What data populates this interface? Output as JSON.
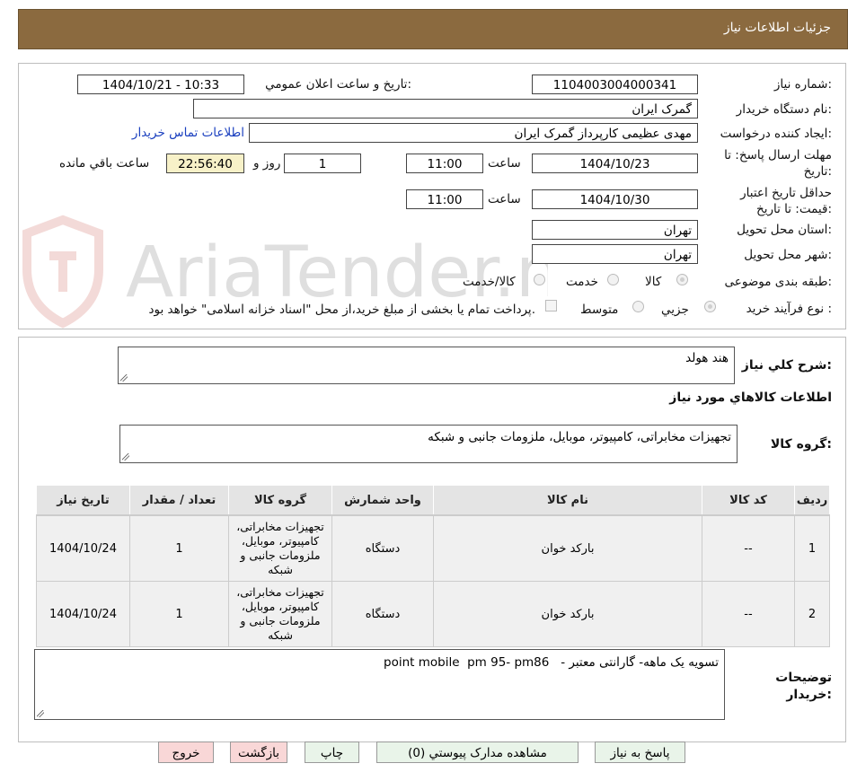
{
  "header": {
    "title": "جزئیات اطلاعات نیاز"
  },
  "form": {
    "need_number_label": "شماره نیاز:",
    "need_number": "1104003004000341",
    "announce_label": "تاریخ و ساعت اعلان عمومي:",
    "announce_value": "1404/10/21 - 10:33",
    "buyer_label": "نام دستگاه خريدار:",
    "buyer_value": "گمرک ایران",
    "creator_label": "ایجاد کننده درخواست:",
    "creator_value": "مهدی عظیمی کارپرداز گمرک ایران",
    "contact_link": "اطلاعات تماس خریدار",
    "deadline_label": "مهلت ارسال پاسخ: تا تاریخ:",
    "deadline_date": "1404/10/23",
    "time_label": "ساعت",
    "deadline_time": "11:00",
    "days_value": "1",
    "days_label": "روز و",
    "remaining_value": "22:56:40",
    "remaining_label": "ساعت باقي مانده",
    "validity_label": "حداقل تاریخ اعتبار قیمت: تا تاریخ:",
    "validity_date": "1404/10/30",
    "validity_time": "11:00",
    "province_label": "استان محل تحویل:",
    "province_value": "تهران",
    "city_label": "شهر محل تحویل:",
    "city_value": "تهران",
    "category_label": "طبقه بندی موضوعی:",
    "cat_goods": "کالا",
    "cat_service": "خدمت",
    "cat_both": "کالا/خدمت",
    "process_label": "نوع فرآیند خرید :",
    "proc_small": "جزیي",
    "proc_medium": "متوسط",
    "payment_note": "پرداخت تمام یا بخشی از مبلغ خرید،از محل \"اسناد خزانه اسلامی\" خواهد بود."
  },
  "watermark": {
    "text": "AriaTender.neT"
  },
  "details": {
    "summary_label": "شرح کلي نياز:",
    "summary_value": "هند هولد",
    "goods_info_title": "اطلاعات کالاهاي مورد نياز",
    "goods_group_label": "گروه کالا:",
    "goods_group_value": "تجهیزات مخابراتی، کامپیوتر، موبایل، ملزومات جانبی و شبکه"
  },
  "table": {
    "headers": [
      "رديف",
      "کد کالا",
      "نام کالا",
      "واحد شمارش",
      "گروه کالا",
      "تعداد / مقدار",
      "تاریخ نیاز"
    ],
    "rows": [
      {
        "row": "1",
        "code": "--",
        "name": "بارکد خوان",
        "unit": "دستگاه",
        "group": "تجهیزات مخابراتی، کامپیوتر، موبایل، ملزومات جانبی و شبکه",
        "qty": "1",
        "date": "1404/10/24"
      },
      {
        "row": "2",
        "code": "--",
        "name": "بارکد خوان",
        "unit": "دستگاه",
        "group": "تجهیزات مخابراتی، کامپیوتر، موبایل، ملزومات جانبی و شبکه",
        "qty": "1",
        "date": "1404/10/24"
      }
    ]
  },
  "buyer_notes": {
    "label": "توضیحات خریدار:",
    "value": "point mobile  pm 95- pm86   - تسویه یک ماهه- گارانتی معتبر"
  },
  "buttons": {
    "reply": "پاسخ به نیاز",
    "attachments": "مشاهده مدارک پیوستي (0)",
    "print": "چاپ",
    "back": "بازگشت",
    "exit": "خروج"
  },
  "colors": {
    "header_bg": "#8B6A3F",
    "link": "#1a3fbf",
    "highlight_box": "#f7f1c8"
  }
}
